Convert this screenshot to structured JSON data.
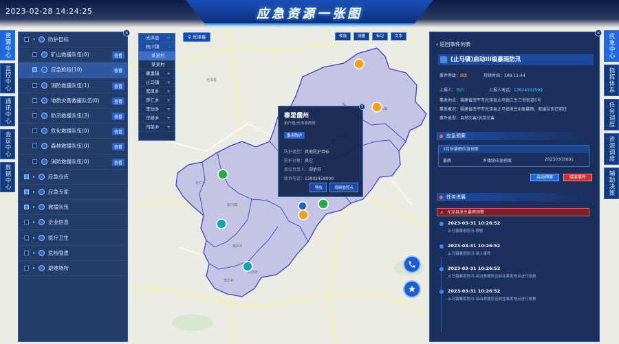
{
  "header": {
    "datetime": "2023-02-28 14:24:25",
    "title": "应急资源一张图"
  },
  "left_nav": [
    "资源中心",
    "监控中心",
    "通讯中心",
    "会议中心",
    "数据中心"
  ],
  "tree": [
    {
      "label": "防护目标",
      "checked": false,
      "level": 0,
      "expanded": true
    },
    {
      "label": "矿山救援队伍(0)",
      "checked": false,
      "level": 1,
      "tag": "查看"
    },
    {
      "label": "应急抢险(10)",
      "checked": true,
      "level": 1,
      "tag": "查看",
      "highlight": true
    },
    {
      "label": "消防救援队伍(1)",
      "checked": false,
      "level": 1,
      "tag": "查看"
    },
    {
      "label": "地质灾害救援队伍(0)",
      "checked": false,
      "level": 1,
      "tag": "查看"
    },
    {
      "label": "防汛救援队伍(3)",
      "checked": false,
      "level": 1,
      "tag": "查看"
    },
    {
      "label": "危化救援队伍(0)",
      "checked": false,
      "level": 1,
      "tag": "查看"
    },
    {
      "label": "森林救援队伍(0)",
      "checked": false,
      "level": 1,
      "tag": "查看"
    },
    {
      "label": "消防救援队伍(0)",
      "checked": false,
      "level": 1,
      "tag": "查看"
    },
    {
      "label": "应急仓库",
      "checked": true,
      "level": 0
    },
    {
      "label": "应急专家",
      "checked": true,
      "level": 0
    },
    {
      "label": "救援队伍",
      "checked": true,
      "level": 0
    },
    {
      "label": "企业信息",
      "checked": false,
      "level": 0
    },
    {
      "label": "医疗卫生",
      "checked": false,
      "level": 0
    },
    {
      "label": "危险隐患",
      "checked": false,
      "level": 0
    },
    {
      "label": "避难场所",
      "checked": false,
      "level": 0
    }
  ],
  "township_dropdown": {
    "header": "光泽县",
    "items": [
      {
        "label": "杭川镇",
        "expand": "-",
        "style": "hd"
      },
      {
        "label": "某某村",
        "style": "sub hl"
      },
      {
        "label": "某某村",
        "style": "sub"
      },
      {
        "label": "寨里镇",
        "expand": "+"
      },
      {
        "label": "止马镇",
        "expand": "+"
      },
      {
        "label": "鸾凤乡",
        "expand": "+"
      },
      {
        "label": "崇仁乡",
        "expand": "+"
      },
      {
        "label": "李坊乡",
        "expand": "+"
      },
      {
        "label": "华桥乡",
        "expand": "+"
      },
      {
        "label": "司前乡",
        "expand": "+"
      }
    ]
  },
  "county_pill": "光泽县",
  "map_tools": [
    "视选",
    "测量",
    "标记",
    "文本"
  ],
  "popup": {
    "title": "寨里儒州",
    "subtitle": "用户组/光泽县政府",
    "badge": "重点防护",
    "lines": [
      {
        "k": "防护类型：",
        "v": "其他防护目标"
      },
      {
        "k": "防护对象：",
        "v": "其它"
      },
      {
        "k": "单位负责人：",
        "v": "郑侨芬"
      },
      {
        "k": "联系电话：",
        "v": "13902458000"
      }
    ],
    "btn_nav": "导航",
    "btn_video": "视频监控点"
  },
  "map_labels": [
    "光泽县",
    "寨里镇",
    "止马镇",
    "华桥乡",
    "鸾凤乡",
    "李坊乡",
    "司前乡",
    "崇仁乡",
    "杭川镇"
  ],
  "right_panel": {
    "back": "返回事件列表",
    "event_title": "(止马镇)启动III级暴雨防汛",
    "level_k": "事件等级：",
    "level_v": "Ⅲ级",
    "duration_k": "持续时间：",
    "duration_v": "189:11:44",
    "reporter_k": "上报人：",
    "reporter_v": "马六",
    "phone_k": "上报人电话：",
    "phone_v": "13824552599",
    "location": "事发地点：福建省南平市光泽县止马镇三生三世街道5号",
    "summary1": "事发概况：福建省南平市光泽县止马镇发生III级暴雨，救援队伍已前往",
    "summary2": "事件类型：自然灾害/洪涝灾害",
    "plan_section": "应急预案",
    "plan_header": "3月份暴雨应急预案",
    "plan_row": [
      "暴雨",
      "乡镇级应急预案",
      "20230303001"
    ],
    "btn_start": "启动预案",
    "btn_end": "结束事件",
    "progress_section": "任务进展",
    "alert": "光泽县发生暴雨预警",
    "timeline": [
      {
        "time": "2023-03-31 10:26:52",
        "desc": "止马镇暴雨防汛-预警"
      },
      {
        "time": "2023-03-31 10:26:52",
        "desc": "止马镇暴雨防汛-录入事件"
      },
      {
        "time": "2023-03-31 10:26:52",
        "desc": "止马镇暴雨防汛-派出救援队伍前往事发地点进行抢救"
      },
      {
        "time": "2023-03-31 10:26:52",
        "desc": "止马镇暴雨防汛-派出救援队伍前往事发地点进行抢救"
      }
    ]
  },
  "right_nav": [
    "应急中心",
    "指挥体系",
    "任务调度",
    "资源调度",
    "辅助决策"
  ],
  "colors": {
    "accent": "#1f6ae0",
    "region_fill": "#b9b8e6",
    "region_stroke": "#3d43c7",
    "danger": "#e25a5a",
    "warning": "#ff9b3d"
  }
}
